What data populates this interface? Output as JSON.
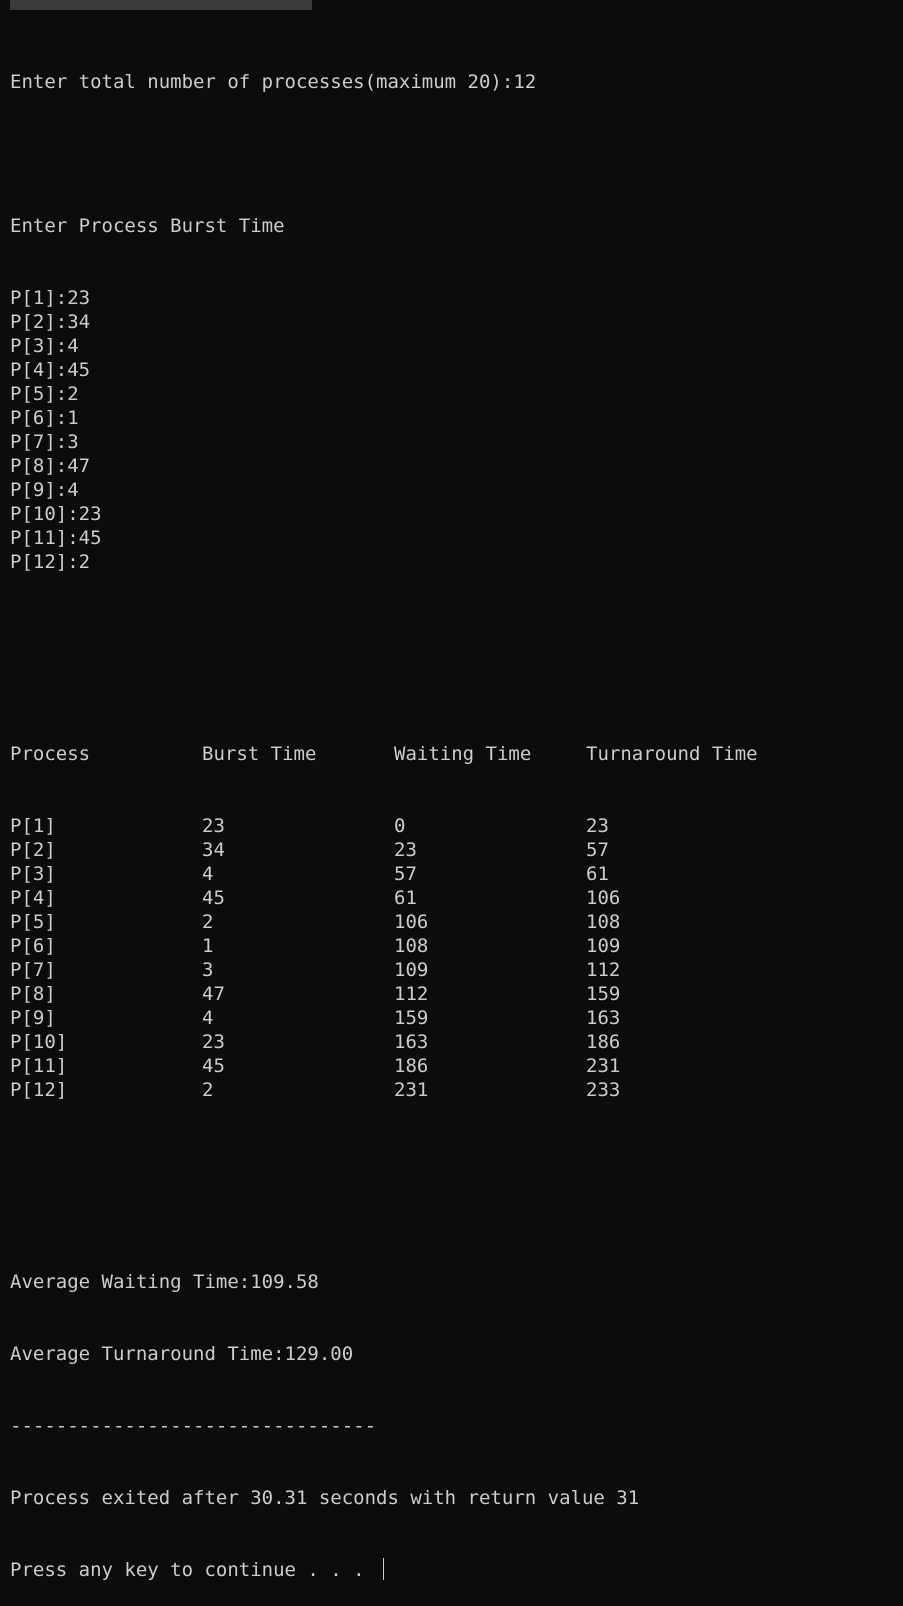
{
  "console": {
    "prompt_line": "Enter total number of processes(maximum 20):12",
    "burst_header": "Enter Process Burst Time",
    "burst_inputs": [
      "P[1]:23",
      "P[2]:34",
      "P[3]:4",
      "P[4]:45",
      "P[5]:2",
      "P[6]:1",
      "P[7]:3",
      "P[8]:47",
      "P[9]:4",
      "P[10]:23",
      "P[11]:45",
      "P[12]:2"
    ],
    "table": {
      "headers": [
        "Process",
        "Burst Time",
        "Waiting Time",
        "Turnaround Time"
      ],
      "rows": [
        [
          "P[1]",
          "23",
          "0",
          "23"
        ],
        [
          "P[2]",
          "34",
          "23",
          "57"
        ],
        [
          "P[3]",
          "4",
          "57",
          "61"
        ],
        [
          "P[4]",
          "45",
          "61",
          "106"
        ],
        [
          "P[5]",
          "2",
          "106",
          "108"
        ],
        [
          "P[6]",
          "1",
          "108",
          "109"
        ],
        [
          "P[7]",
          "3",
          "109",
          "112"
        ],
        [
          "P[8]",
          "47",
          "112",
          "159"
        ],
        [
          "P[9]",
          "4",
          "159",
          "163"
        ],
        [
          "P[10]",
          "23",
          "163",
          "186"
        ],
        [
          "P[11]",
          "45",
          "186",
          "231"
        ],
        [
          "P[12]",
          "2",
          "231",
          "233"
        ]
      ]
    },
    "avg_waiting": "Average Waiting Time:109.58",
    "avg_turnaround": "Average Turnaround Time:129.00",
    "separator": "--------------------------------",
    "exit_line": "Process exited after 30.31 seconds with return value 31",
    "continue_line": "Press any key to continue . . . "
  }
}
